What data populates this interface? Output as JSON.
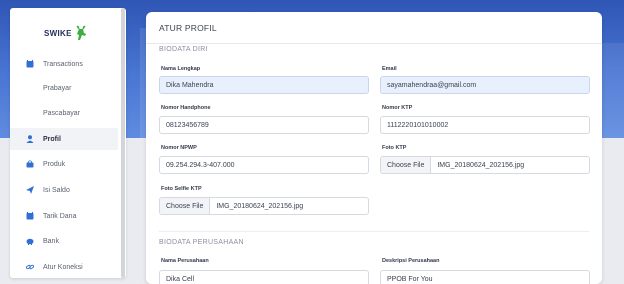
{
  "brand": {
    "name": "SWIKE"
  },
  "sidebar": {
    "items": [
      {
        "label": "Transactions",
        "icon": "calendar-icon"
      },
      {
        "label": "Prabayar",
        "icon": ""
      },
      {
        "label": "Pascabayar",
        "icon": ""
      },
      {
        "label": "Profil",
        "icon": "user-icon",
        "active": true
      },
      {
        "label": "Produk",
        "icon": "bag-icon"
      },
      {
        "label": "Isi Saldo",
        "icon": "send-icon"
      },
      {
        "label": "Tarik Dana",
        "icon": "calendar-icon"
      },
      {
        "label": "Bank",
        "icon": "piggy-bank-icon"
      },
      {
        "label": "Atur Koneksi",
        "icon": "link-icon"
      }
    ]
  },
  "main": {
    "title": "ATUR PROFIL",
    "biodata_diri": {
      "title": "BIODATA DIRI",
      "nama_lengkap": {
        "label": "Nama Lengkap",
        "value": "Dika Mahendra"
      },
      "email": {
        "label": "Email",
        "value": "sayamahendraa@gmail.com"
      },
      "nomor_handphone": {
        "label": "Nomor Handphone",
        "value": "08123456789"
      },
      "nomor_ktp": {
        "label": "Nomor KTP",
        "value": "1112220101010002"
      },
      "nomor_npwp": {
        "label": "Nomor NPWP",
        "value": "09.254.294.3-407.000"
      },
      "foto_ktp": {
        "label": "Foto KTP",
        "button": "Choose File",
        "file": "IMG_20180624_202156.jpg"
      },
      "foto_selfie_ktp": {
        "label": "Foto Selfie KTP",
        "button": "Choose File",
        "file": "IMG_20180624_202156.jpg"
      }
    },
    "biodata_perusahaan": {
      "title": "BIODATA PERUSAHAAN",
      "nama_perusahaan": {
        "label": "Nama Perusahaan",
        "value": "Dika Cell"
      },
      "deskripsi_perusahaan": {
        "label": "Deskripsi Perusahaan",
        "value": "PPOB For You"
      }
    }
  },
  "colors": {
    "accent": "#2f56b5",
    "sidebar_active_bg": "#f1f3f7",
    "autofill_bg": "#e8f0fe"
  }
}
